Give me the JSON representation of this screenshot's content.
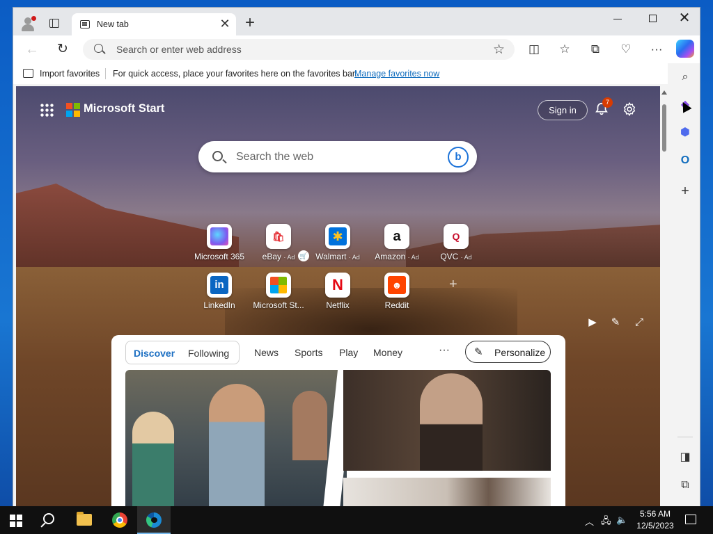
{
  "browser": {
    "tab_title": "New tab",
    "tab_close": "✕",
    "new_tab": "+",
    "address_placeholder": "Search or enter web address",
    "favorites_bar": {
      "import_label": "Import favorites",
      "message": "For quick access, place your favorites here on the favorites bar.",
      "manage_link": "Manage favorites now"
    }
  },
  "page": {
    "brand": "Microsoft Start",
    "signin": "Sign in",
    "notification_count": "7",
    "search_placeholder": "Search the web",
    "tiles": [
      {
        "label": "Microsoft 365",
        "ad": "",
        "icon": "microsoft-365-icon"
      },
      {
        "label": "eBay",
        "ad": "· Ad",
        "icon": "ebay-icon"
      },
      {
        "label": "Walmart",
        "ad": "· Ad",
        "icon": "walmart-icon"
      },
      {
        "label": "Amazon",
        "ad": "· Ad",
        "icon": "amazon-icon"
      },
      {
        "label": "QVC",
        "ad": "· Ad",
        "icon": "qvc-icon"
      },
      {
        "label": "LinkedIn",
        "ad": "",
        "icon": "linkedin-icon"
      },
      {
        "label": "Microsoft St...",
        "ad": "",
        "icon": "microsoft-store-icon"
      },
      {
        "label": "Netflix",
        "ad": "",
        "icon": "netflix-icon"
      },
      {
        "label": "Reddit",
        "ad": "",
        "icon": "reddit-icon"
      }
    ],
    "feed": {
      "tabs": [
        "Discover",
        "Following"
      ],
      "active_tab": "Discover",
      "nav": [
        "News",
        "Sports",
        "Play",
        "Money"
      ],
      "more": "···",
      "personalize": "Personalize"
    }
  },
  "taskbar": {
    "time": "5:56 AM",
    "date": "12/5/2023"
  },
  "colors": {
    "accent": "#1b6ec2",
    "link": "#0f6cbd",
    "badge": "#d83b01"
  }
}
